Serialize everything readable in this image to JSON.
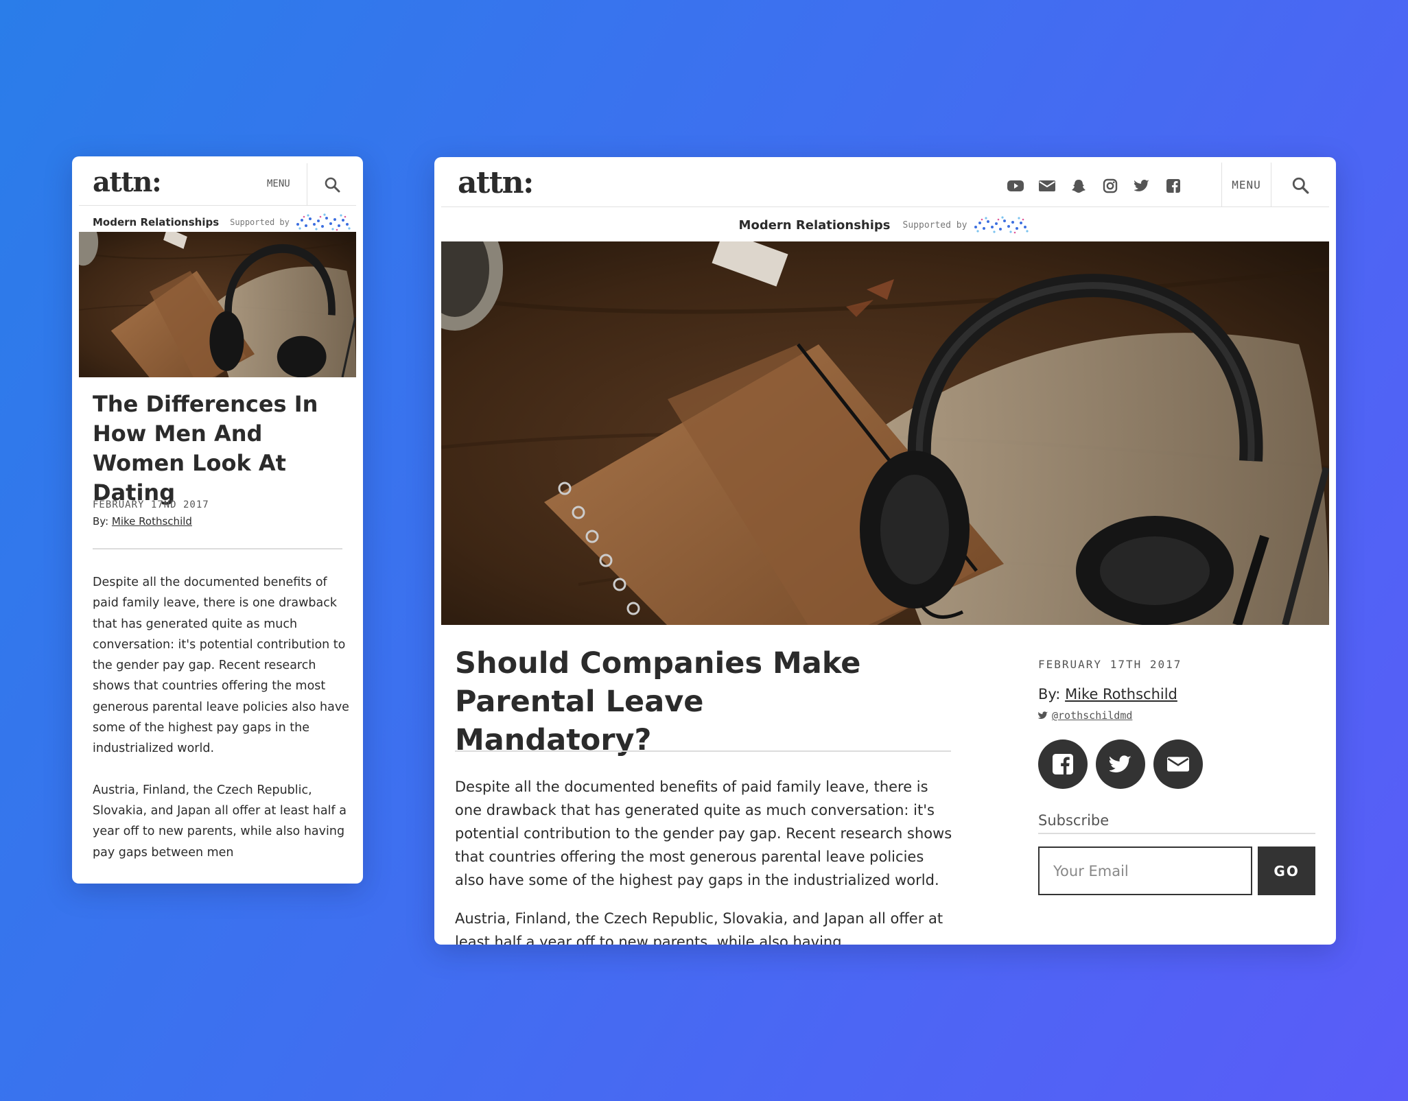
{
  "mobile": {
    "logo": "attn:",
    "menu_label": "MENU",
    "topic": "Modern Relationships",
    "supported_by": "Supported by",
    "title": "The Differences In How Men And Women Look At Dating",
    "date": "FEBRUARY 17ND 2017",
    "by_prefix": "By:",
    "author": "Mike Rothschild",
    "paragraphs": [
      "Despite all the documented benefits of paid family leave, there is one drawback that has generated quite as much conversation: it's potential contribution to the gender pay gap. Recent research shows that countries offering the most generous parental leave policies also have some of the highest pay gaps in the industrialized world.",
      "Austria, Finland, the Czech Republic, Slovakia, and Japan all offer at least half a year off to new parents, while also having pay gaps between men"
    ]
  },
  "desktop": {
    "logo": "attn:",
    "social_icons": [
      "youtube-icon",
      "mail-icon",
      "snapchat-icon",
      "instagram-icon",
      "twitter-icon",
      "facebook-icon"
    ],
    "menu_label": "MENU",
    "topic": "Modern Relationships",
    "supported_by": "Supported by",
    "title": "Should Companies Make Parental Leave Mandatory?",
    "paragraphs": [
      "Despite all the documented benefits of paid family leave, there is one drawback that has generated quite as much conversation: it's potential contribution to the gender pay gap. Recent research shows that countries offering the most generous parental leave policies also have some of the highest pay gaps in the industrialized world.",
      "Austria, Finland, the Czech Republic, Slovakia, and Japan all offer at least half a year off to new parents, while also having"
    ],
    "date": "FEBRUARY 17TH 2017",
    "by_prefix": "By:",
    "author": "Mike Rothschild",
    "twitter_handle": "@rothschildmd",
    "share_buttons": [
      "facebook-icon",
      "twitter-icon",
      "mail-icon"
    ],
    "subscribe_label": "Subscribe",
    "email_placeholder": "Your Email",
    "go_label": "GO"
  },
  "colors": {
    "background_start": "#2a7de9",
    "background_end": "#5a5cf8",
    "text": "#2b2b2b",
    "button": "#333333"
  }
}
